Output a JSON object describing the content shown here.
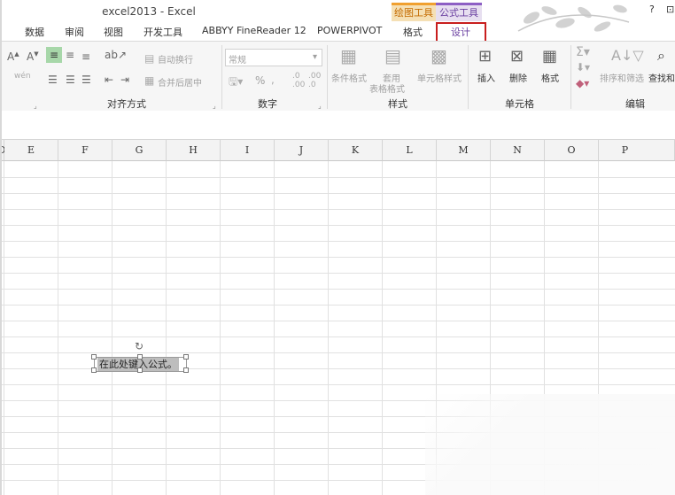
{
  "window": {
    "title": "excel2013 - Excel",
    "contextual": {
      "drawing_tools": "绘图工具",
      "formula_tools": "公式工具"
    },
    "buttons": [
      "?",
      "⊡"
    ]
  },
  "tabs": [
    "数据",
    "审阅",
    "视图",
    "开发工具",
    "ABBYY FineReader 12",
    "POWERPIVOT",
    "格式",
    "设计"
  ],
  "ribbon": {
    "alignment": {
      "label": "对齐方式",
      "wrap_text": "自动换行",
      "merge_center": "合并后居中"
    },
    "number": {
      "label": "数字",
      "format_value": "常规",
      "percent": "%"
    },
    "styles": {
      "label": "样式",
      "conditional": "条件格式",
      "table_line1": "套用",
      "table_line2": "表格格式",
      "cell_styles": "单元格样式"
    },
    "cells": {
      "label": "单元格",
      "insert": "插入",
      "delete": "删除",
      "format": "格式"
    },
    "editing": {
      "label": "编辑",
      "sort_filter": "排序和筛选",
      "find": "查找和"
    }
  },
  "sheet": {
    "columns": [
      "D",
      "E",
      "F",
      "G",
      "H",
      "I",
      "J",
      "K",
      "L",
      "M",
      "N",
      "O",
      "P"
    ],
    "equation_placeholder": "在此处键入公式。"
  },
  "colors": {
    "highlight": "#c81e1e",
    "drawing_tools": "#f0a030",
    "formula_tools": "#8d5fc4"
  }
}
